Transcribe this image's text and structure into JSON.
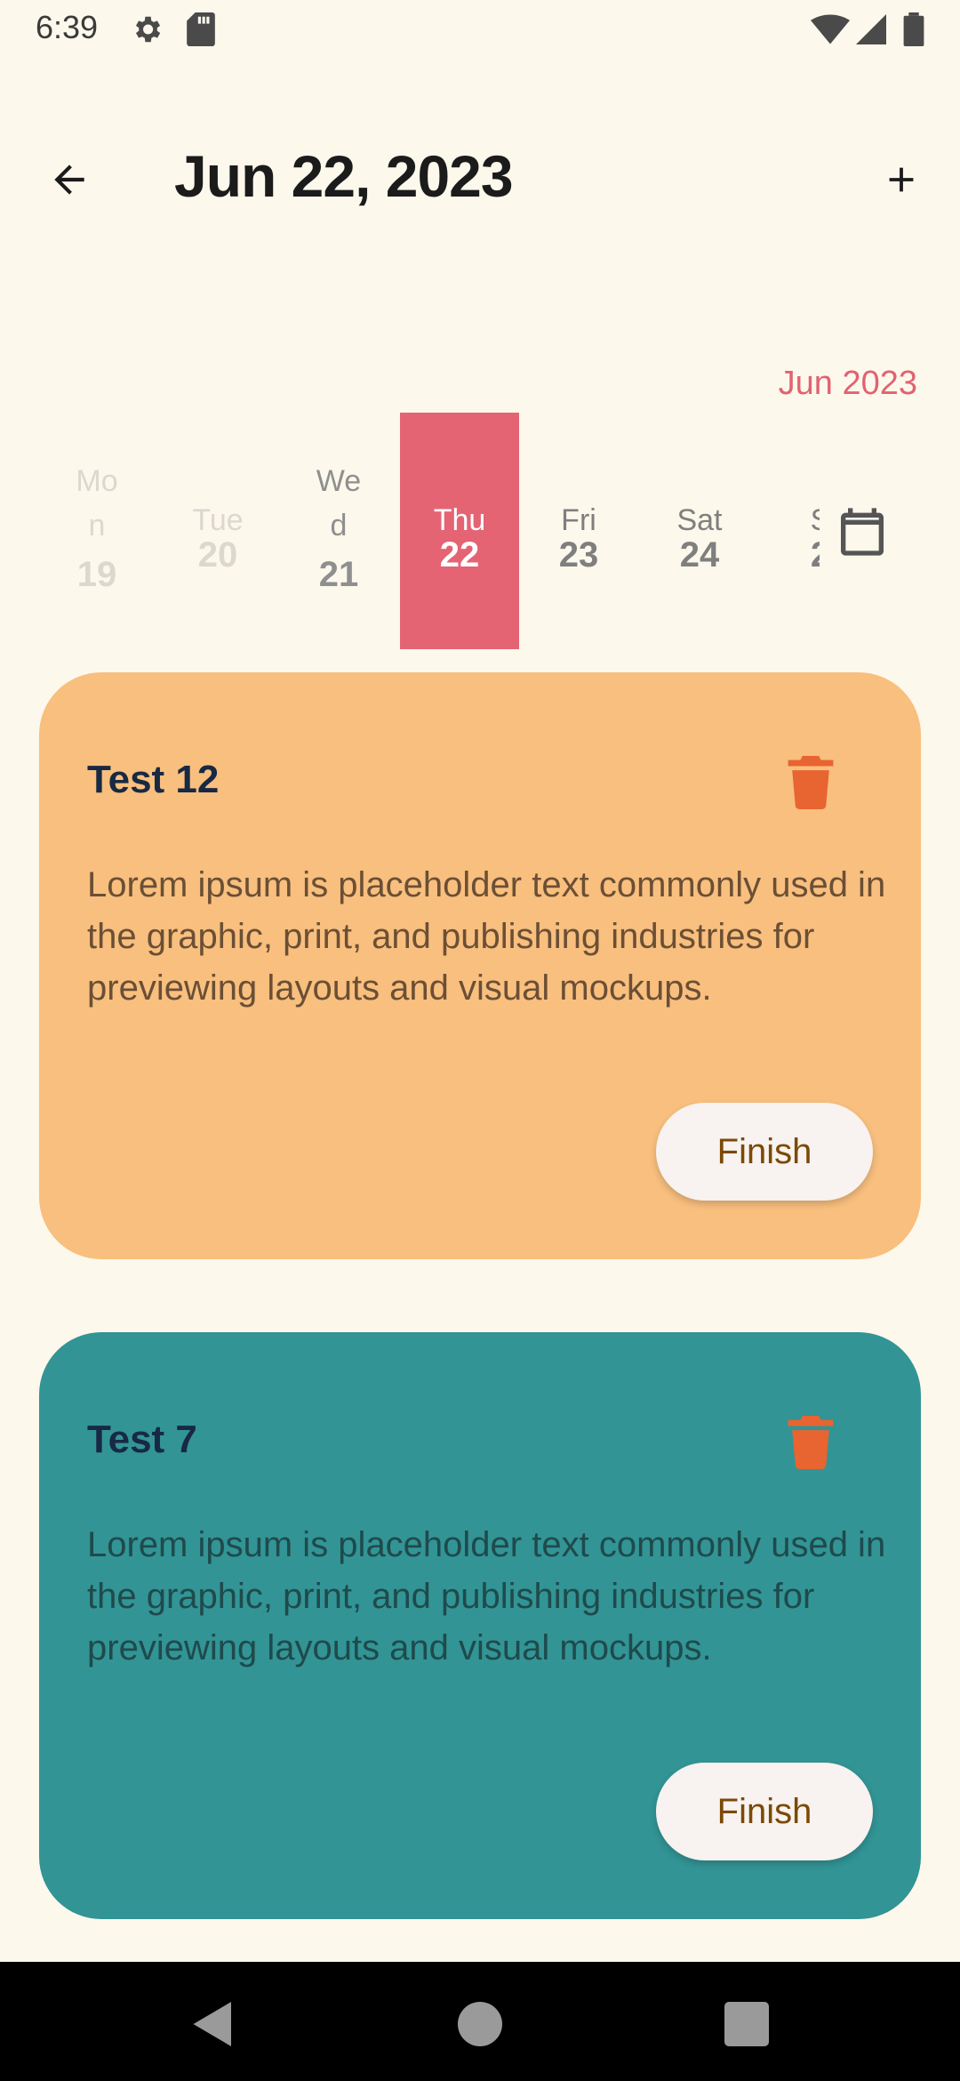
{
  "status_bar": {
    "time": "6:39"
  },
  "header": {
    "title": "Jun 22, 2023"
  },
  "calendar": {
    "month_label": "Jun 2023",
    "days": [
      {
        "name": "Mo\nn",
        "num": "19"
      },
      {
        "name": "Tue",
        "num": "20"
      },
      {
        "name": "We\nd",
        "num": "21"
      },
      {
        "name": "Thu",
        "num": "22"
      },
      {
        "name": "Fri",
        "num": "23"
      },
      {
        "name": "Sat",
        "num": "24"
      },
      {
        "name": "S",
        "num": "2"
      }
    ],
    "selected_index": 3
  },
  "tasks": [
    {
      "title": "Test 12",
      "body": "Lorem ipsum is placeholder text commonly used in the graphic, print, and publishing industries for previewing layouts and visual mockups.",
      "button": "Finish",
      "color": "#f8bf7e"
    },
    {
      "title": "Test 7",
      "body": "Lorem ipsum is placeholder text commonly used in the graphic, print, and publishing industries for previewing layouts and visual mockups.",
      "button": "Finish",
      "color": "#329495"
    }
  ],
  "colors": {
    "accent": "#e46474",
    "delete_icon": "#e86430",
    "background": "#fdf8ec"
  },
  "icons": [
    "back-arrow-icon",
    "plus-icon",
    "calendar-icon",
    "trash-icon",
    "gear-icon",
    "sd-card-icon",
    "wifi-icon",
    "signal-icon",
    "battery-icon"
  ]
}
